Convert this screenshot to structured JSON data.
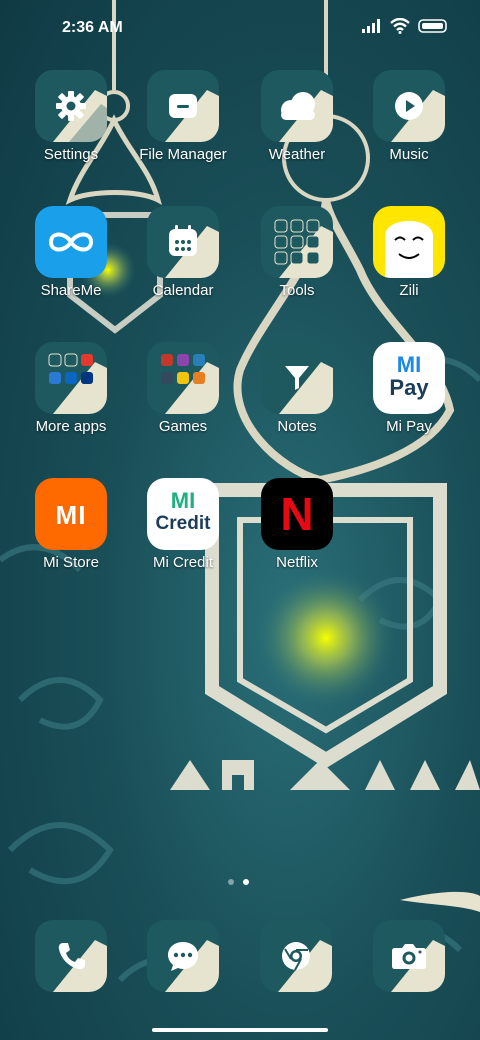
{
  "status_bar": {
    "time": "2:36 AM"
  },
  "apps": [
    {
      "id": "settings",
      "label": "Settings",
      "icon": "gear-icon"
    },
    {
      "id": "file-manager",
      "label": "File Manager",
      "icon": "folder-icon"
    },
    {
      "id": "weather",
      "label": "Weather",
      "icon": "cloud-icon"
    },
    {
      "id": "music",
      "label": "Music",
      "icon": "play-icon"
    },
    {
      "id": "shareme",
      "label": "ShareMe",
      "icon": "infinity-icon"
    },
    {
      "id": "calendar",
      "label": "Calendar",
      "icon": "calendar-icon"
    },
    {
      "id": "tools",
      "label": "Tools",
      "icon": "folder-grid-icon"
    },
    {
      "id": "zili",
      "label": "Zili",
      "icon": "smiley-icon"
    },
    {
      "id": "more-apps",
      "label": "More apps",
      "icon": "folder-grid-icon"
    },
    {
      "id": "games",
      "label": "Games",
      "icon": "folder-grid-icon"
    },
    {
      "id": "notes",
      "label": "Notes",
      "icon": "funnel-icon"
    },
    {
      "id": "mi-pay",
      "label": "Mi Pay",
      "icon": "mipay-icon",
      "icon_text_1": "MI",
      "icon_text_2": "Pay"
    },
    {
      "id": "mi-store",
      "label": "Mi Store",
      "icon": "mi-logo-icon",
      "icon_text_1": "MI"
    },
    {
      "id": "mi-credit",
      "label": "Mi Credit",
      "icon": "micredit-icon",
      "icon_text_1": "MI",
      "icon_text_2": "Credit"
    },
    {
      "id": "netflix",
      "label": "Netflix",
      "icon": "netflix-icon",
      "icon_text_1": "N"
    }
  ],
  "dock": [
    {
      "id": "phone",
      "icon": "phone-icon"
    },
    {
      "id": "messages",
      "icon": "chat-icon"
    },
    {
      "id": "browser",
      "icon": "chrome-icon"
    },
    {
      "id": "camera",
      "icon": "camera-icon"
    }
  ],
  "page_indicator": {
    "pages": 2,
    "current": 2
  },
  "colors": {
    "tile_teal": "#1f5960",
    "swoosh": "#e6e3cf",
    "shareme": "#1aa0ea",
    "zili": "#ffe600",
    "mi_store": "#ff6a00",
    "netflix_red": "#e50914"
  }
}
